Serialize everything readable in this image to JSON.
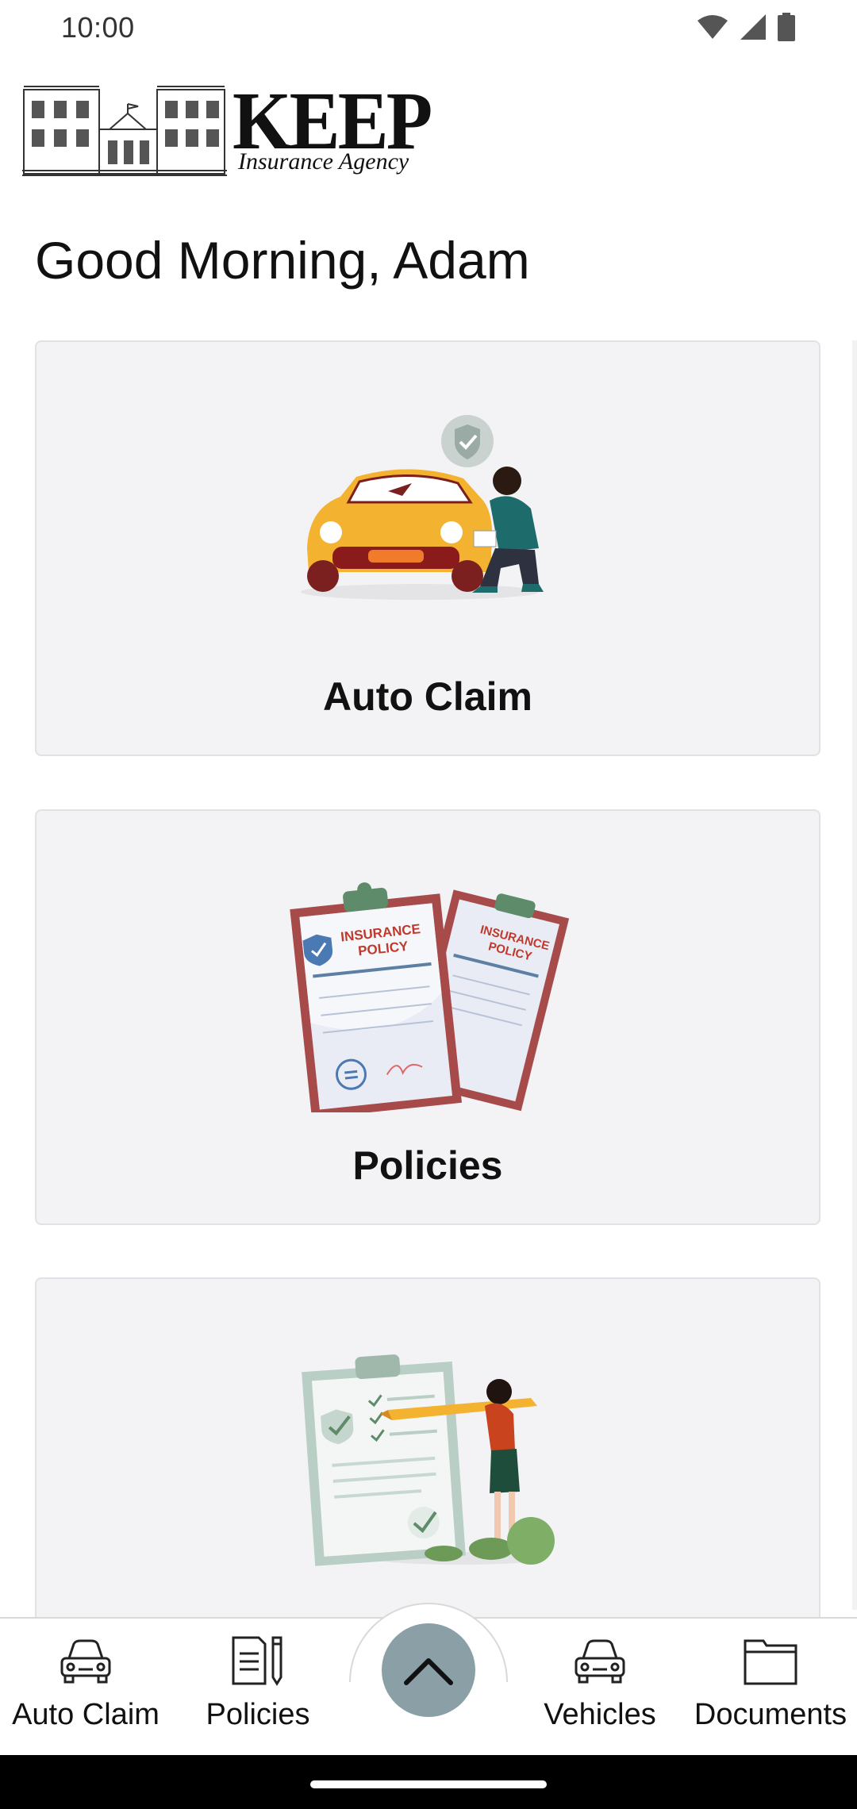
{
  "status_bar": {
    "time": "10:00",
    "icons": [
      "wifi-icon",
      "cellular-signal-icon",
      "battery-icon"
    ]
  },
  "logo": {
    "title": "KEEP",
    "subtitle": "Insurance Agency"
  },
  "greeting": "Good Morning, Adam",
  "cards": [
    {
      "label": "Auto Claim",
      "illustration": "auto-claim-illustration"
    },
    {
      "label": "Policies",
      "illustration": "insurance-policy-illustration"
    },
    {
      "label": "",
      "illustration": "checklist-illustration"
    }
  ],
  "bottom_nav": {
    "items": [
      {
        "label": "Auto Claim",
        "icon": "car-icon"
      },
      {
        "label": "Policies",
        "icon": "document-pencil-icon"
      },
      {
        "label": "Vehicles",
        "icon": "car-icon"
      },
      {
        "label": "Documents",
        "icon": "folder-icon"
      }
    ],
    "center_button_icon": "chevron-up-icon"
  },
  "colors": {
    "card_background": "#f3f3f5",
    "card_border": "#e2e2e6",
    "center_button": "#8a9fa6",
    "text": "#111111"
  }
}
